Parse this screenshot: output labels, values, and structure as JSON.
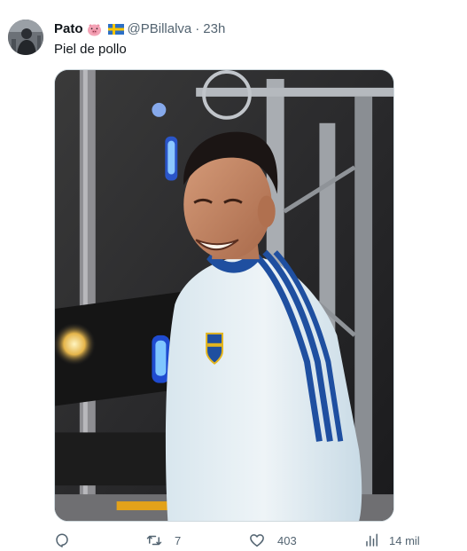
{
  "author": {
    "name": "Pato",
    "handle": "@PBillalva",
    "separator": "·",
    "time": "23h",
    "emojis": [
      "pig-face-icon",
      "sweden-flag-icon"
    ]
  },
  "tweet": {
    "text": "Piel de pollo"
  },
  "media": {
    "description_icon": "photo-icon"
  },
  "actions": {
    "reply_count": "",
    "retweet_count": "7",
    "like_count": "403",
    "views_count": "14 mil"
  },
  "colors": {
    "text": "#0f1419",
    "muted": "#536471",
    "border": "#cfd9de",
    "jersey_blue": "#1f4fa0"
  }
}
